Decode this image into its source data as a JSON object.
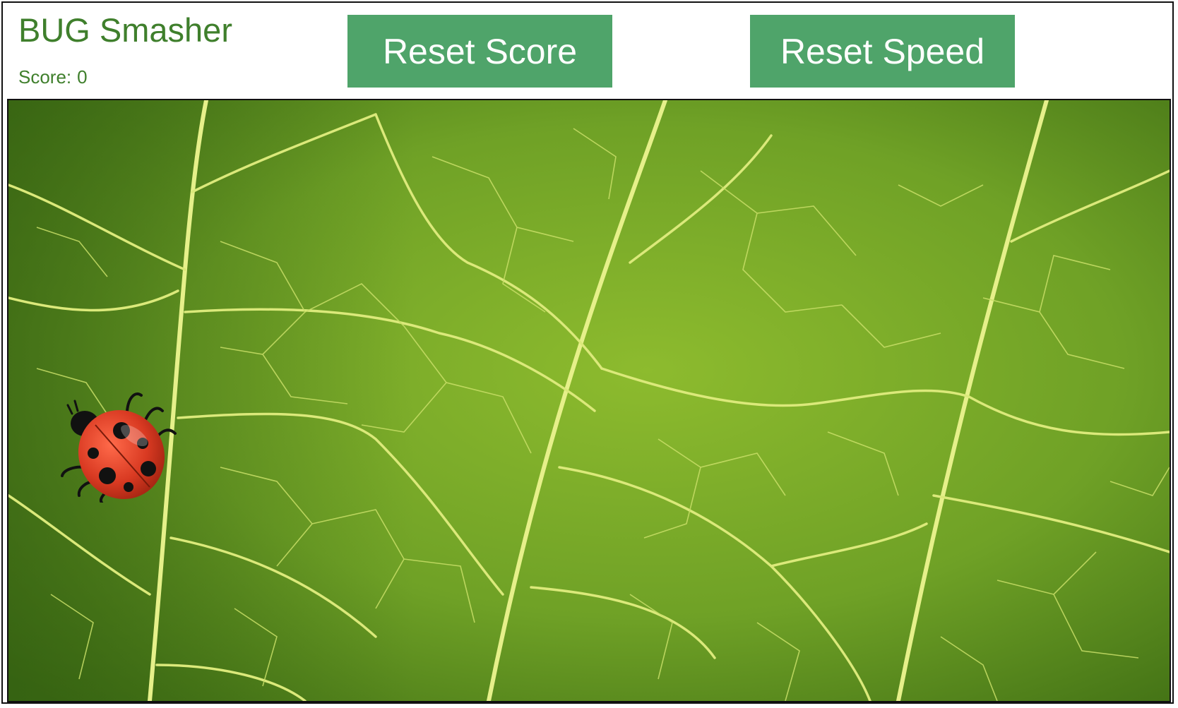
{
  "app": {
    "title": "BUG Smasher"
  },
  "score": {
    "label": "Score:",
    "value": "0"
  },
  "buttons": {
    "reset_score": "Reset Score",
    "reset_speed": "Reset Speed"
  },
  "game": {
    "background": "green-leaf-vein-texture",
    "bug_icon": "ladybug-icon"
  },
  "colors": {
    "title_text": "#3f7f2c",
    "button_bg": "#4fa46a",
    "button_text": "#ffffff",
    "ladybug_red": "#d93a22"
  }
}
